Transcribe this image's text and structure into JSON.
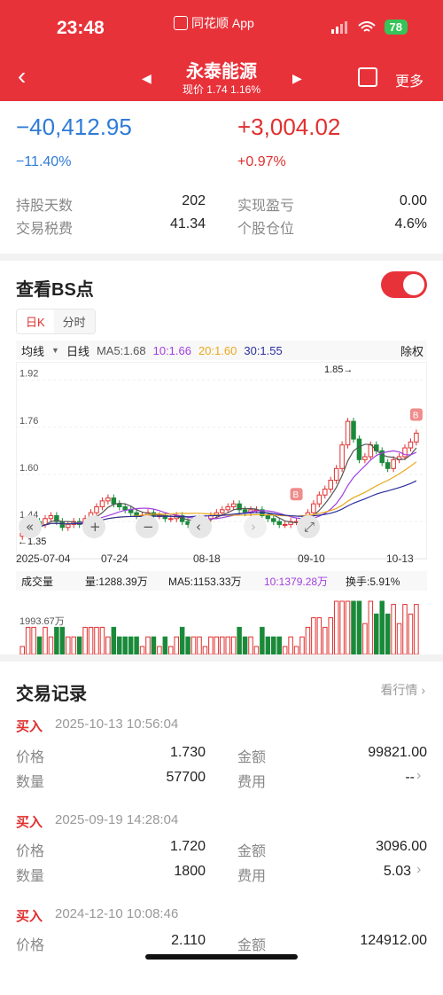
{
  "status_bar": {
    "time": "23:48",
    "app_name": "同花顺 App",
    "battery": "78"
  },
  "nav": {
    "title": "永泰能源",
    "subtitle": "现价 1.74 1.16%",
    "more_label": "更多"
  },
  "summary": {
    "float_pnl": "−40,412.95",
    "float_pnl_pct": "−11.40%",
    "day_pnl": "+3,004.02",
    "day_pnl_pct": "+0.97%",
    "rows": [
      {
        "l1": "持股天数",
        "v1": "202",
        "l2": "实现盈亏",
        "v2": "0.00"
      },
      {
        "l1": "交易税费",
        "v1": "41.34",
        "l2": "个股仓位",
        "v2": "4.6%"
      }
    ]
  },
  "bs": {
    "title": "查看BS点",
    "tabs": [
      "日K",
      "分时"
    ],
    "ma_row": {
      "type": "均线",
      "period": "日线",
      "ma5": "MA5:1.68",
      "ma10": "10:1.66",
      "ma20": "20:1.60",
      "ma30": "30:1.55",
      "adjust": "除权"
    },
    "vol_row": {
      "label": "成交量",
      "vol": "量:1288.39万",
      "ma5": "MA5:1153.33万",
      "ma10": "10:1379.28万",
      "turnover": "换手:5.91%"
    }
  },
  "chart_data": {
    "type": "candlestick",
    "y_ticks": [
      "1.92",
      "1.76",
      "1.60",
      "1.44"
    ],
    "x_ticks": [
      "2025-07-04",
      "07-24",
      "08-18",
      "09-10",
      "10-13"
    ],
    "annotations": {
      "high": "1.85→",
      "low": "←1.35",
      "buy_marker": "B"
    },
    "volume_tick": "1993.67万",
    "ylim": [
      1.35,
      1.94
    ],
    "closes": [
      1.4,
      1.42,
      1.44,
      1.43,
      1.45,
      1.46,
      1.44,
      1.42,
      1.43,
      1.44,
      1.43,
      1.45,
      1.47,
      1.49,
      1.51,
      1.52,
      1.5,
      1.49,
      1.48,
      1.47,
      1.46,
      1.46,
      1.47,
      1.46,
      1.46,
      1.45,
      1.45,
      1.46,
      1.44,
      1.43,
      1.44,
      1.45,
      1.45,
      1.46,
      1.47,
      1.48,
      1.49,
      1.5,
      1.48,
      1.47,
      1.48,
      1.48,
      1.46,
      1.45,
      1.44,
      1.43,
      1.43,
      1.44,
      1.44,
      1.45,
      1.47,
      1.5,
      1.53,
      1.55,
      1.58,
      1.62,
      1.7,
      1.78,
      1.72,
      1.65,
      1.66,
      1.7,
      1.68,
      1.64,
      1.62,
      1.65,
      1.66,
      1.69,
      1.71,
      1.74
    ]
  },
  "controls": [
    "collapse",
    "zoom-in",
    "zoom-out",
    "prev",
    "next",
    "fullscreen"
  ],
  "records": {
    "title": "交易记录",
    "more": "看行情",
    "items": [
      {
        "type": "买入",
        "datetime": "2025-10-13 10:56:04",
        "price_label": "价格",
        "price": "1.730",
        "amount_label": "金额",
        "amount": "99821.00",
        "qty_label": "数量",
        "qty": "57700",
        "fee_label": "费用",
        "fee": "--"
      },
      {
        "type": "买入",
        "datetime": "2025-09-19 14:28:04",
        "price_label": "价格",
        "price": "1.720",
        "amount_label": "金额",
        "amount": "3096.00",
        "qty_label": "数量",
        "qty": "1800",
        "fee_label": "费用",
        "fee": "5.03"
      },
      {
        "type": "买入",
        "datetime": "2024-12-10 10:08:46",
        "price_label": "价格",
        "price": "2.110",
        "amount_label": "金额",
        "amount": "124912.00"
      }
    ]
  }
}
